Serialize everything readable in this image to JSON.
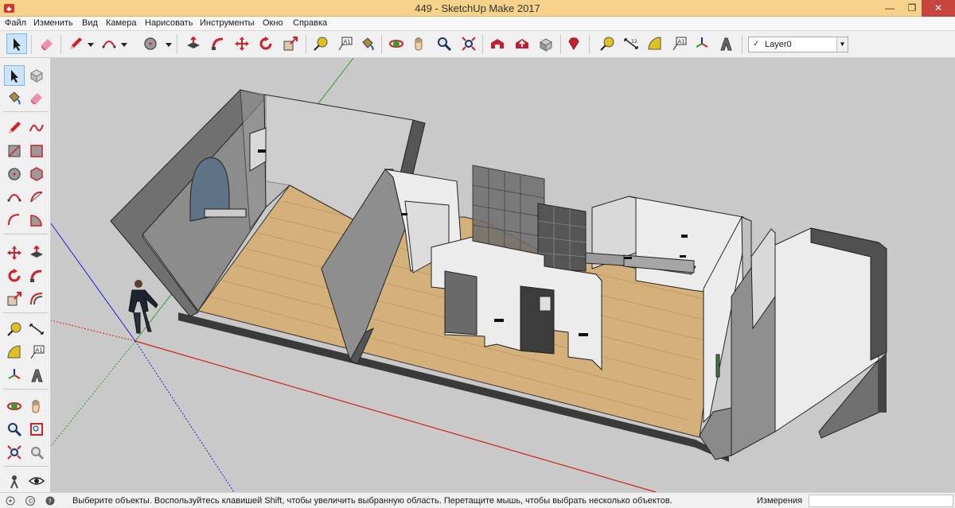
{
  "window": {
    "title": "449 - SketchUp Make 2017",
    "minimize_glyph": "—",
    "maximize_glyph": "❐",
    "close_glyph": "✕"
  },
  "menu": [
    {
      "label": "Файл"
    },
    {
      "label": "Изменить"
    },
    {
      "label": "Вид"
    },
    {
      "label": "Камера"
    },
    {
      "label": "Нарисовать"
    },
    {
      "label": "Инструменты"
    },
    {
      "label": "Окно"
    },
    {
      "label": "Справка"
    }
  ],
  "toolbar": {
    "layer": {
      "check": "✓",
      "value": "Layer0",
      "arrow": "▼"
    }
  },
  "status": {
    "hint": "Выберите объекты. Воспользуйтесь клавишей Shift, чтобы увеличить выбранную область. Перетащите мышь, чтобы выбрать несколько объектов.",
    "measurements_label": "Измерения",
    "measurements_value": ""
  },
  "colors": {
    "titlebar": "#f6d28a",
    "close": "#c7453c",
    "sky": "#c9c9c9",
    "floor": "#d4b07a",
    "wall_light": "#e8e8e8",
    "wall_dark": "#707070",
    "axis_red": "#d22020",
    "axis_green": "#2e9e2e",
    "axis_blue": "#2020d2"
  }
}
